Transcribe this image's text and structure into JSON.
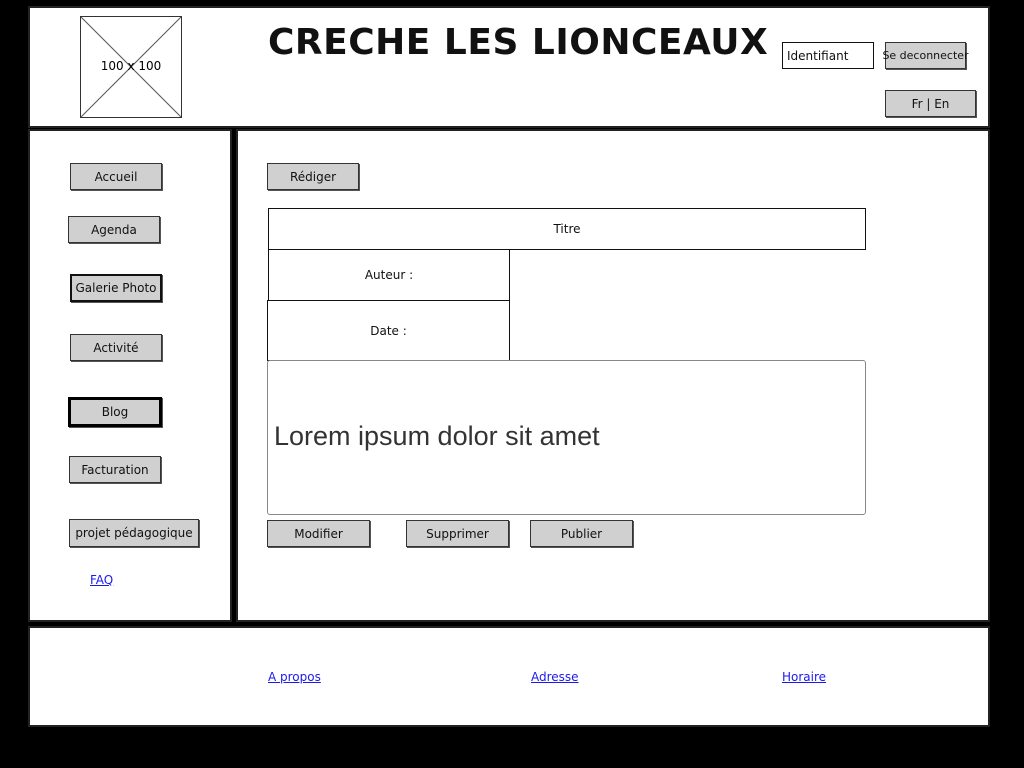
{
  "header": {
    "logo_placeholder": "100 x 100",
    "site_title": "CRECHE LES LIONCEAUX",
    "login_field": "Identifiant",
    "logout_button": "Se deconnecter",
    "lang_toggle": "Fr | En"
  },
  "sidebar": {
    "items": [
      {
        "label": "Accueil"
      },
      {
        "label": "Agenda"
      },
      {
        "label": "Galerie Photo"
      },
      {
        "label": "Activité"
      },
      {
        "label": "Blog"
      },
      {
        "label": "Facturation"
      },
      {
        "label": "projet pédagogique"
      }
    ],
    "faq_link": "FAQ"
  },
  "main": {
    "write_button": "Rédiger",
    "title_field": "Titre",
    "author_field": "Auteur :",
    "date_field": "Date :",
    "body_text": "Lorem ipsum dolor sit amet",
    "actions": {
      "modify": "Modifier",
      "delete": "Supprimer",
      "publish": "Publier"
    }
  },
  "footer": {
    "about_link": "A propos",
    "address_link": "Adresse",
    "hours_link": "Horaire"
  }
}
